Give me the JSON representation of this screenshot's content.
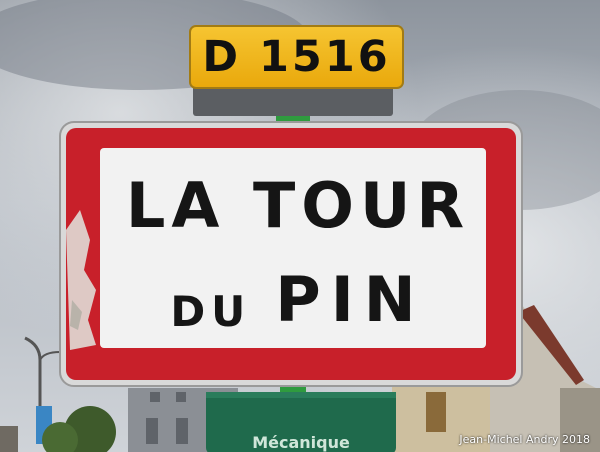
{
  "road_sign": {
    "number": "D 1516"
  },
  "town_sign": {
    "line1": "LA TOUR",
    "line2_small": "DU",
    "line2_big": "PIN"
  },
  "bottom_sign": {
    "text": "Mécanique"
  },
  "credit": {
    "text": "Jean-Michel Andry 2018"
  },
  "colors": {
    "sign_border": "#c8202a",
    "sign_background": "#f2f2f2",
    "road_plate": "#f0b414",
    "sky": "#aeb5be",
    "green_sign": "#1f6a4c"
  }
}
